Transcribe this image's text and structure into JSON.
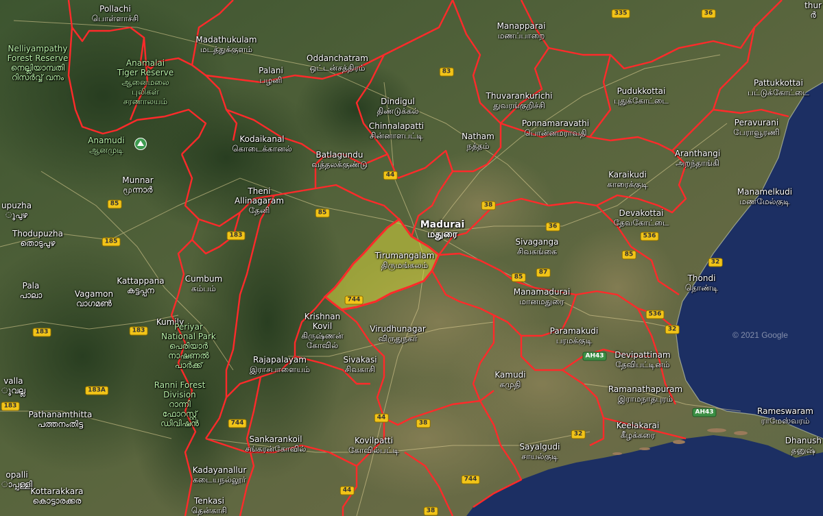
{
  "map": {
    "copyright": "© 2021 Google",
    "highlight_color": "#d4d43a",
    "boundary_color": "#ff2a2a",
    "sea_color": "#1c2f63"
  },
  "places": [
    {
      "id": "pollachi",
      "en": "Pollachi",
      "ta": "பொள்ளாச்சி"
    },
    {
      "id": "madathukulam",
      "en": "Madathukulam",
      "ta": "மடத்துக்குளம்"
    },
    {
      "id": "oddanchatram",
      "en": "Oddanchatram",
      "ta": "ஒட்டன்சத்திரம்"
    },
    {
      "id": "manapparai",
      "en": "Manapparai",
      "ta": "மணப்பாறை"
    },
    {
      "id": "nelliyampathy",
      "en": "Nelliyampathy\nForest Reserve",
      "ta": "നെല്ലിയാമ്പതി\nറിസർവ്വ് വനം"
    },
    {
      "id": "anamalai",
      "en": "Anamalai\nTiger Reserve",
      "ta": "ஆனைமலை\nபுலிகள்\nசரணாலயம்"
    },
    {
      "id": "palani",
      "en": "Palani",
      "ta": "பழனி"
    },
    {
      "id": "dindigul",
      "en": "Dindigul",
      "ta": "திண்டுக்கல்"
    },
    {
      "id": "thuvarankurichi",
      "en": "Thuvarankurichi",
      "ta": "துவரங்குறிச்சி"
    },
    {
      "id": "pudukkottai",
      "en": "Pudukkottai",
      "ta": "புதுக்கோட்டை"
    },
    {
      "id": "pattukkottai",
      "en": "Pattukkottai",
      "ta": "பட்டுக்கோட்டை"
    },
    {
      "id": "chinnalapatti",
      "en": "Chinnalapatti",
      "ta": "சின்னாளபட்டி"
    },
    {
      "id": "ponnamaravathi",
      "en": "Ponnamaravathi",
      "ta": "பொன்னமராவதி"
    },
    {
      "id": "peravurani",
      "en": "Peravurani",
      "ta": "பேராவூரணி"
    },
    {
      "id": "natham",
      "en": "Natham",
      "ta": "நத்தம்"
    },
    {
      "id": "anamudi",
      "en": "Anamudi",
      "ta": "ஆனமுடி"
    },
    {
      "id": "kodaikanal",
      "en": "Kodaikanal",
      "ta": "கொடைக்கானல்"
    },
    {
      "id": "batlagundu",
      "en": "Batlagundu",
      "ta": "வத்தலக்குண்டு"
    },
    {
      "id": "aranthangi",
      "en": "Aranthangi",
      "ta": "அறந்தாங்கி"
    },
    {
      "id": "munnar",
      "en": "Munnar",
      "ta": "மூന്നാർ"
    },
    {
      "id": "karaikudi",
      "en": "Karaikudi",
      "ta": "காரைக்குடி"
    },
    {
      "id": "manamelkudi",
      "en": "Manamelkudi",
      "ta": "மணமேல்குடி"
    },
    {
      "id": "theni",
      "en": "Theni\nAllinagaram",
      "ta": "தேனி"
    },
    {
      "id": "madurai",
      "en": "Madurai",
      "ta": "மதுரை"
    },
    {
      "id": "devakottai",
      "en": "Devakottai",
      "ta": "தேவகோட்டை"
    },
    {
      "id": "thodupuzha",
      "en": "Thodupuzha",
      "ta": "തൊടുപുഴ"
    },
    {
      "id": "upuzha",
      "en": "upuzha",
      "ta": "ുപുഴ"
    },
    {
      "id": "sivaganga",
      "en": "Sivaganga",
      "ta": "சிவகங்கை"
    },
    {
      "id": "tirumangalam",
      "en": "Tirumangalam",
      "ta": "திருமங்கலம்"
    },
    {
      "id": "kattappana",
      "en": "Kattappana",
      "ta": "കട്ടപ്പന"
    },
    {
      "id": "cumbum",
      "en": "Cumbum",
      "ta": "கம்பம்"
    },
    {
      "id": "thondi",
      "en": "Thondi",
      "ta": "தொண்டி"
    },
    {
      "id": "pala",
      "en": "Pala",
      "ta": "പാലാ"
    },
    {
      "id": "vagamon",
      "en": "Vagamon",
      "ta": "വാഗമൺ"
    },
    {
      "id": "manamadurai",
      "en": "Manamadurai",
      "ta": "மானமதுரை"
    },
    {
      "id": "kumily",
      "en": "Kumily",
      "ta": ""
    },
    {
      "id": "krishnankovil",
      "en": "Krishnan\nKovil",
      "ta": "கிருஷ்ணன்\nகோவில்"
    },
    {
      "id": "virudhunagar",
      "en": "Virudhunagar",
      "ta": "விருதுநகர்"
    },
    {
      "id": "paramakudi",
      "en": "Paramakudi",
      "ta": "பரமக்குடி"
    },
    {
      "id": "periyar",
      "en": "Periyar\nNational Park",
      "ta": "പെരിയാർ\nനാഷണൽ\nപാർക്ക്"
    },
    {
      "id": "devipattinam",
      "en": "Devipattinam",
      "ta": "தேவிபட்டினம்"
    },
    {
      "id": "rajapalayam",
      "en": "Rajapalayam",
      "ta": "இராசபாளையம்"
    },
    {
      "id": "sivakasi",
      "en": "Sivakasi",
      "ta": "சிவகாசி"
    },
    {
      "id": "kamudi",
      "en": "Kamudi",
      "ta": "கமுதி"
    },
    {
      "id": "ramanathapuram",
      "en": "Ramanathapuram",
      "ta": "இராமநாதபுரம்"
    },
    {
      "id": "valla",
      "en": "valla",
      "ta": "ുവല്ല"
    },
    {
      "id": "ranni",
      "en": "Ranni Forest\nDivision",
      "ta": "റാന്നി\nഫോറസ്റ്റ്\nഡിവിഷൻ"
    },
    {
      "id": "rameswaram",
      "en": "Rameswaram",
      "ta": "ராமேஸ்வரம்"
    },
    {
      "id": "pathanamthitta",
      "en": "Pathanamthitta",
      "ta": "പത്തനംതിട്ട"
    },
    {
      "id": "keelakarai",
      "en": "Keelakarai",
      "ta": "கீழக்கரை"
    },
    {
      "id": "sankarankoil",
      "en": "Sankarankoil",
      "ta": "சங்கரன்கோவில்"
    },
    {
      "id": "kovilpatti",
      "en": "Kovilpatti",
      "ta": "கோவில்பட்டி"
    },
    {
      "id": "sayalgudi",
      "en": "Sayalgudi",
      "ta": "சாயல்குடி"
    },
    {
      "id": "dhanushkodi",
      "en": "Dhanush",
      "ta": "தனுஷ்"
    },
    {
      "id": "kadayanallur",
      "en": "Kadayanallur",
      "ta": "கடையநல்லூர்"
    },
    {
      "id": "opalli",
      "en": "opalli",
      "ta": "ാപ്പള്ളി"
    },
    {
      "id": "kottarakkara",
      "en": "Kottarakkara",
      "ta": "കൊട്ടാരക്കര"
    },
    {
      "id": "tenkasi",
      "en": "Tenkasi",
      "ta": "தென்காசி"
    },
    {
      "id": "thur",
      "en": "thur",
      "ta": "ർ"
    }
  ],
  "shields": [
    {
      "id": "s335",
      "text": "335"
    },
    {
      "id": "s36a",
      "text": "36"
    },
    {
      "id": "s83",
      "text": "83"
    },
    {
      "id": "s44a",
      "text": "44"
    },
    {
      "id": "s85a",
      "text": "85"
    },
    {
      "id": "s85b",
      "text": "85"
    },
    {
      "id": "s38a",
      "text": "38"
    },
    {
      "id": "s36b",
      "text": "36"
    },
    {
      "id": "s536a",
      "text": "536"
    },
    {
      "id": "s183a",
      "text": "183"
    },
    {
      "id": "s185",
      "text": "185"
    },
    {
      "id": "s85c",
      "text": "85"
    },
    {
      "id": "s32a",
      "text": "32"
    },
    {
      "id": "s87",
      "text": "87"
    },
    {
      "id": "s85d",
      "text": "85"
    },
    {
      "id": "s744a",
      "text": "744"
    },
    {
      "id": "s536b",
      "text": "536"
    },
    {
      "id": "s183b",
      "text": "183"
    },
    {
      "id": "s183c",
      "text": "183"
    },
    {
      "id": "s32b",
      "text": "32"
    },
    {
      "id": "s183A",
      "text": "183A"
    },
    {
      "id": "s183d",
      "text": "183"
    },
    {
      "id": "s744b",
      "text": "744"
    },
    {
      "id": "s44b",
      "text": "44"
    },
    {
      "id": "s38b",
      "text": "38"
    },
    {
      "id": "s32c",
      "text": "32"
    },
    {
      "id": "s744c",
      "text": "744"
    },
    {
      "id": "s44c",
      "text": "44"
    },
    {
      "id": "s38c",
      "text": "38"
    },
    {
      "id": "sAH43a",
      "text": "AH43",
      "green": true
    },
    {
      "id": "sAH43b",
      "text": "AH43",
      "green": true
    }
  ]
}
